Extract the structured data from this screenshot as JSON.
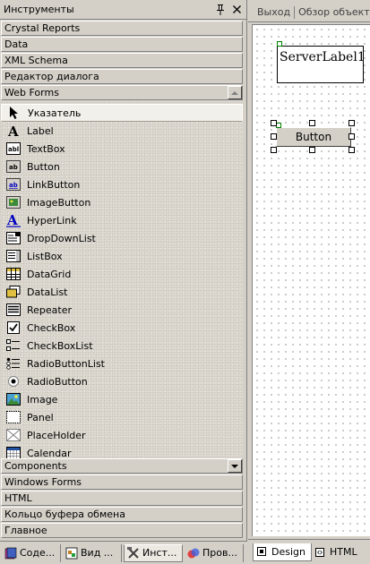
{
  "toolbox": {
    "title": "Инструменты",
    "pin_glyph": "🖈",
    "close_glyph": "✕",
    "groups_top": [
      "Crystal Reports",
      "Data",
      "XML Schema",
      "Редактор диалога",
      "Web Forms"
    ],
    "webforms_items": [
      {
        "label": "Указатель",
        "icon": "pointer-icon",
        "selected": true
      },
      {
        "label": "Label",
        "icon": "label-icon"
      },
      {
        "label": "TextBox",
        "icon": "textbox-icon"
      },
      {
        "label": "Button",
        "icon": "button-icon"
      },
      {
        "label": "LinkButton",
        "icon": "linkbutton-icon"
      },
      {
        "label": "ImageButton",
        "icon": "imagebutton-icon"
      },
      {
        "label": "HyperLink",
        "icon": "hyperlink-icon"
      },
      {
        "label": "DropDownList",
        "icon": "dropdownlist-icon"
      },
      {
        "label": "ListBox",
        "icon": "listbox-icon"
      },
      {
        "label": "DataGrid",
        "icon": "datagrid-icon"
      },
      {
        "label": "DataList",
        "icon": "datalist-icon"
      },
      {
        "label": "Repeater",
        "icon": "repeater-icon"
      },
      {
        "label": "CheckBox",
        "icon": "checkbox-icon"
      },
      {
        "label": "CheckBoxList",
        "icon": "checkboxlist-icon"
      },
      {
        "label": "RadioButtonList",
        "icon": "radiobuttonlist-icon"
      },
      {
        "label": "RadioButton",
        "icon": "radiobutton-icon"
      },
      {
        "label": "Image",
        "icon": "image-icon"
      },
      {
        "label": "Panel",
        "icon": "panel-icon"
      },
      {
        "label": "PlaceHolder",
        "icon": "placeholder-icon"
      },
      {
        "label": "Calendar",
        "icon": "calendar-icon"
      }
    ],
    "groups_bottom": [
      "Components",
      "Windows Forms",
      "HTML",
      "Кольцо буфера обмена",
      "Главное"
    ],
    "bottom_tabs": [
      {
        "label": "Соде...",
        "icon": "contents-icon",
        "active": false
      },
      {
        "label": "Вид ...",
        "icon": "class-view-icon",
        "active": false
      },
      {
        "label": "Инст...",
        "icon": "toolbox-icon",
        "active": true
      },
      {
        "label": "Пров...",
        "icon": "explorer-icon",
        "active": false
      }
    ]
  },
  "designer": {
    "doc_tabs": [
      "Выход",
      "Обзор объекта"
    ],
    "server_label_text": "ServerLabel1",
    "button_text": "Button",
    "view_tabs": [
      {
        "label": "Design",
        "icon": "design-view-icon",
        "active": true
      },
      {
        "label": "HTML",
        "icon": "html-view-icon",
        "active": false
      }
    ]
  },
  "colors": {
    "face": "#d4d0c8",
    "selected_item": "#f2f0ea",
    "canvas": "#ffffff",
    "glyph_green": "#008000"
  }
}
